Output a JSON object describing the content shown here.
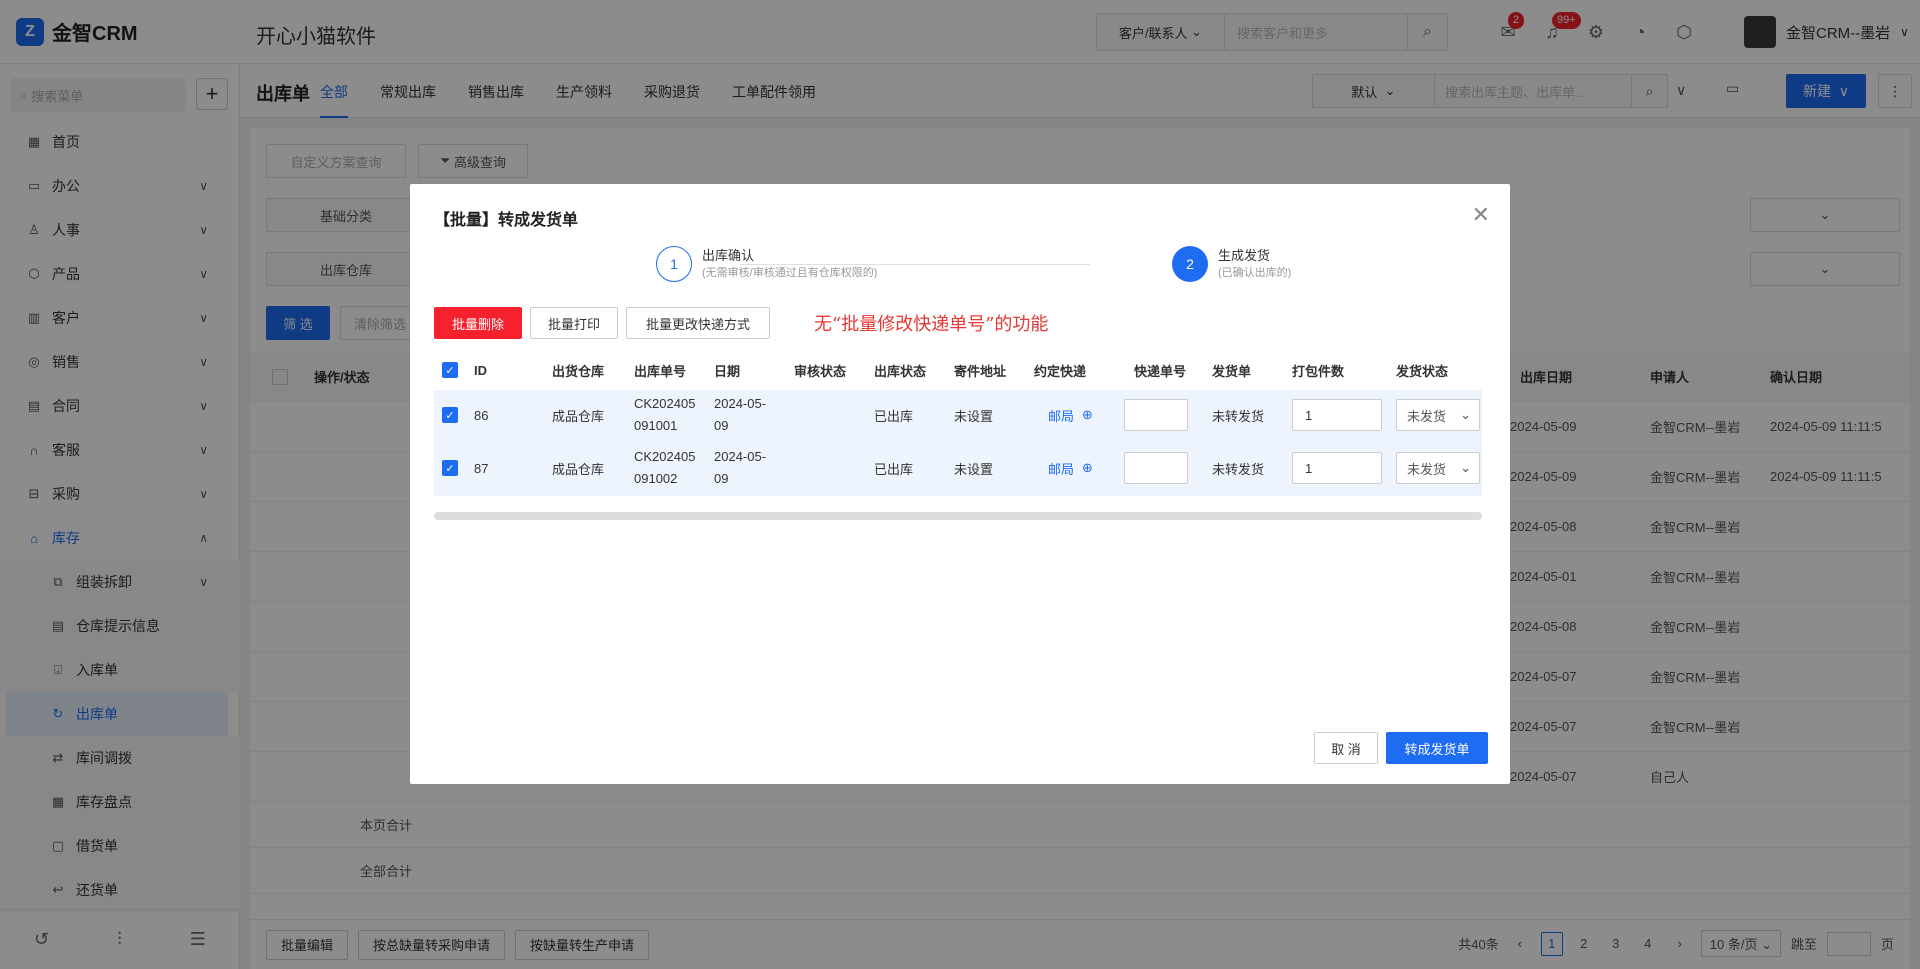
{
  "app": {
    "logo_text": "金智CRM",
    "company": "开心小猫软件"
  },
  "topbar": {
    "search_scope": "客户/联系人",
    "search_placeholder": "搜索客户和更多",
    "message_badge": "2",
    "notice_badge": "99+",
    "user_name": "金智CRM--墨岩"
  },
  "sidebar": {
    "search_placeholder": "搜索菜单",
    "items": [
      {
        "label": "首页",
        "icon": "home-icon",
        "chev": false
      },
      {
        "label": "办公",
        "icon": "briefcase-icon",
        "chev": true
      },
      {
        "label": "人事",
        "icon": "people-icon",
        "chev": true
      },
      {
        "label": "产品",
        "icon": "cube-icon",
        "chev": true
      },
      {
        "label": "客户",
        "icon": "chart-icon",
        "chev": true
      },
      {
        "label": "销售",
        "icon": "sales-icon",
        "chev": true
      },
      {
        "label": "合同",
        "icon": "contract-icon",
        "chev": true
      },
      {
        "label": "客服",
        "icon": "headset-icon",
        "chev": true
      },
      {
        "label": "采购",
        "icon": "cart-icon",
        "chev": true
      },
      {
        "label": "库存",
        "icon": "warehouse-icon",
        "chev": true,
        "active": true
      }
    ],
    "sub_items": [
      {
        "label": "组装拆卸",
        "chev": true
      },
      {
        "label": "仓库提示信息"
      },
      {
        "label": "入库单"
      },
      {
        "label": "出库单",
        "selected": true
      },
      {
        "label": "库间调拨"
      },
      {
        "label": "库存盘点"
      },
      {
        "label": "借货单"
      },
      {
        "label": "还货单"
      }
    ]
  },
  "page": {
    "title": "出库单",
    "tabs": [
      "全部",
      "常规出库",
      "销售出库",
      "生产领料",
      "采购退货",
      "工单配件领用"
    ],
    "view_select": "默认",
    "search_placeholder": "搜索出库主题、出库单...",
    "new_button": "新建"
  },
  "filters": {
    "custom_query": "自定义方案查询",
    "advanced_query": "高级查询",
    "basic_category": "基础分类",
    "out_warehouse": "出库仓库",
    "filter_btn": "筛 选",
    "clear_btn": "清除筛选"
  },
  "bg_table": {
    "headers": [
      "操作/状态",
      "出库日期",
      "申请人",
      "确认日期"
    ],
    "rows": [
      {
        "date": "2024-05-09",
        "applicant": "金智CRM--墨岩",
        "confirm": "2024-05-09 11:11:5"
      },
      {
        "date": "2024-05-09",
        "applicant": "金智CRM--墨岩",
        "confirm": "2024-05-09 11:11:5"
      },
      {
        "date": "2024-05-08",
        "applicant": "金智CRM--墨岩",
        "confirm": ""
      },
      {
        "date": "2024-05-01",
        "applicant": "金智CRM--墨岩",
        "confirm": ""
      },
      {
        "date": "2024-05-08",
        "applicant": "金智CRM--墨岩",
        "confirm": ""
      },
      {
        "date": "2024-05-07",
        "applicant": "金智CRM--墨岩",
        "confirm": ""
      },
      {
        "date": "2024-05-07",
        "applicant": "金智CRM--墨岩",
        "confirm": ""
      },
      {
        "date": "2024-05-07",
        "applicant": "自己人",
        "confirm": ""
      }
    ],
    "page_total": "本页合计",
    "all_total": "全部合计"
  },
  "footer": {
    "buttons": [
      "批量编辑",
      "按总缺量转采购申请",
      "按缺量转生产申请"
    ],
    "total": "共40条",
    "pages": [
      "1",
      "2",
      "3",
      "4"
    ],
    "page_size": "10 条/页",
    "jump": "跳至",
    "page_unit": "页"
  },
  "modal": {
    "title": "【批量】转成发货单",
    "step1_num": "1",
    "step1_title": "出库确认",
    "step1_desc": "(无需审核/审核通过且有仓库权限的)",
    "step2_num": "2",
    "step2_title": "生成发货",
    "step2_desc": "(已确认出库的)",
    "btn_delete": "批量删除",
    "btn_print": "批量打印",
    "btn_change_express": "批量更改快递方式",
    "note": "无“批量修改快递单号”的功能",
    "headers": [
      "ID",
      "出货仓库",
      "出库单号",
      "日期",
      "审核状态",
      "出库状态",
      "寄件地址",
      "约定快递",
      "快递单号",
      "发货单",
      "打包件数",
      "发货状态"
    ],
    "rows": [
      {
        "id": "86",
        "warehouse": "成品仓库",
        "no1": "CK202405",
        "no2": "091001",
        "date1": "2024-05-",
        "date2": "09",
        "audit": "",
        "out_status": "已出库",
        "address": "未设置",
        "express": "邮局",
        "tracking": "",
        "ship_order": "未转发货",
        "packages": "1",
        "ship_status": "未发货"
      },
      {
        "id": "87",
        "warehouse": "成品仓库",
        "no1": "CK202405",
        "no2": "091002",
        "date1": "2024-05-",
        "date2": "09",
        "audit": "",
        "out_status": "已出库",
        "address": "未设置",
        "express": "邮局",
        "tracking": "",
        "ship_order": "未转发货",
        "packages": "1",
        "ship_status": "未发货"
      }
    ],
    "cancel": "取 消",
    "confirm": "转成发货单"
  }
}
